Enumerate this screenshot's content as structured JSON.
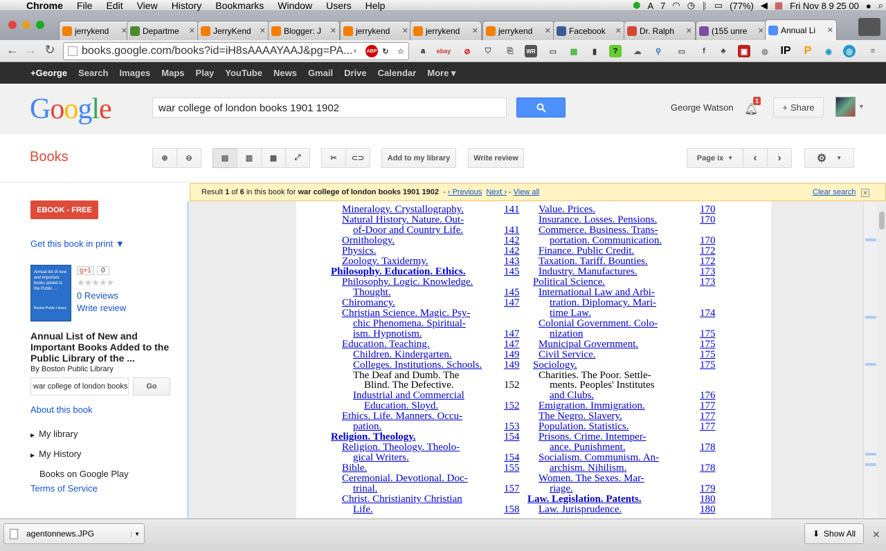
{
  "menubar": {
    "app": "Chrome",
    "items": [
      "File",
      "Edit",
      "View",
      "History",
      "Bookmarks",
      "Window",
      "Users",
      "Help"
    ],
    "battery": "(77%)",
    "clock": "Fri Nov 8  9 25 00",
    "badge_num": "7"
  },
  "tabs": [
    {
      "label": "jerrykend",
      "icon": "blogger-icon",
      "color": "#f57d00"
    },
    {
      "label": "Departme",
      "icon": "leaf-icon",
      "color": "#4a8a2e"
    },
    {
      "label": "JerryKend",
      "icon": "blogger-icon",
      "color": "#f57d00"
    },
    {
      "label": "Blogger: J",
      "icon": "blogger-icon",
      "color": "#f57d00"
    },
    {
      "label": "jerrykend",
      "icon": "blogger-icon",
      "color": "#f57d00"
    },
    {
      "label": "jerrykend",
      "icon": "blogger-icon",
      "color": "#f57d00"
    },
    {
      "label": "jerrykend",
      "icon": "blogger-icon",
      "color": "#f57d00"
    },
    {
      "label": "Facebook",
      "icon": "facebook-icon",
      "color": "#3b5998"
    },
    {
      "label": "Dr. Ralph",
      "icon": "gmail-icon",
      "color": "#d14836"
    },
    {
      "label": "(155 unre",
      "icon": "mail-icon",
      "color": "#7b4fa3"
    },
    {
      "label": "Annual Li",
      "icon": "google-icon",
      "color": "#4d90fe"
    }
  ],
  "toolbar": {
    "url": "books.google.com/books?id=iH8sAAAAYAAJ&pg=PA..."
  },
  "gbar": [
    "+George",
    "Search",
    "Images",
    "Maps",
    "Play",
    "YouTube",
    "News",
    "Gmail",
    "Drive",
    "Calendar",
    "More ▾"
  ],
  "header": {
    "logo": "Google",
    "query": "war college of london books 1901 1902",
    "user": "George Watson",
    "notif_count": "1",
    "share": "Share"
  },
  "books": {
    "title": "Books",
    "add_library": "Add to my library",
    "write_review": "Write review",
    "page_select": "Page ix"
  },
  "sidebar": {
    "ebook": "EBOOK - FREE",
    "get_print": "Get this book in print ▼",
    "cover_text": "Annual list of new and important books added to the Public ...",
    "cover_pub": "Boston Public Library",
    "gplus": "g+1",
    "gplus_count": "0",
    "reviews": "0 Reviews",
    "write_review": "Write review",
    "book_title": "Annual List of New and Important Books Added to the Public Library of the ...",
    "author": "By Boston Public Library",
    "search_value": "war college of london books",
    "go": "Go",
    "about": "About this book",
    "my_library": "My library",
    "my_history": "My History",
    "play": "Books on Google Play",
    "terms": "Terms of Service"
  },
  "resultbar": {
    "result_prefix": "Result ",
    "result_num": "1",
    "of_text": " of ",
    "total": "6",
    "in_book": " in this book for ",
    "query": "war college of london books 1901 1902",
    "prev": "‹ Previous",
    "next": "Next ›",
    "view_all": "View all",
    "clear": "Clear search"
  },
  "page": {
    "left_col": [
      {
        "t": "Mineralogy.  Crystallography.",
        "p": "141",
        "i": 1,
        "hl": true
      },
      {
        "t": "Natural History.  Nature.  Out-",
        "p": "",
        "i": 1,
        "hl": true
      },
      {
        "t": "of-Door and Country Life.",
        "p": "141",
        "i": 2,
        "hl": true
      },
      {
        "t": "Ornithology.",
        "p": "142",
        "i": 1,
        "hl": true
      },
      {
        "t": "Physics.",
        "p": "142",
        "i": 1,
        "hl": true
      },
      {
        "t": "Zoology.  Taxidermy.",
        "p": "143",
        "i": 1,
        "hl": true
      },
      {
        "t": "Philosophy.  Education.  Ethics.",
        "p": "145",
        "i": 0,
        "hl": true,
        "sec": true
      },
      {
        "t": "Philosophy.  Logic.  Knowledge.",
        "p": "",
        "i": 1,
        "hl": true
      },
      {
        "t": "Thought.",
        "p": "145",
        "i": 2,
        "hl": true
      },
      {
        "t": "Chiromancy.",
        "p": "147",
        "i": 1,
        "hl": true
      },
      {
        "t": "Christian Science.  Magic.  Psy-",
        "p": "",
        "i": 1,
        "hl": true
      },
      {
        "t": "chic  Phenomena.  Spiritual-",
        "p": "",
        "i": 2,
        "hl": true
      },
      {
        "t": "ism.  Hypnotism.",
        "p": "147",
        "i": 2,
        "hl": true
      },
      {
        "t": "Education.  Teaching.",
        "p": "147",
        "i": 1,
        "hl": true
      },
      {
        "t": "Children.  Kindergarten.",
        "p": "149",
        "i": 2,
        "hl": true
      },
      {
        "t": "Colleges. Institutions. Schools.",
        "p": "149",
        "i": 2,
        "hl": true
      },
      {
        "t": "The  Deaf  and  Dumb.   The",
        "p": "",
        "i": 2,
        "hl": false
      },
      {
        "t": "Blind.  The Defective.",
        "p": "152",
        "i": 3,
        "hl": false
      },
      {
        "t": "Industrial  and  Commercial",
        "p": "",
        "i": 2,
        "hl": true
      },
      {
        "t": "Education.  Sloyd.",
        "p": "152",
        "i": 3,
        "hl": true
      },
      {
        "t": "Ethics.  Life.  Manners.  Occu-",
        "p": "",
        "i": 1,
        "hl": true
      },
      {
        "t": "pation.",
        "p": "153",
        "i": 2,
        "hl": true
      },
      {
        "t": "Religion.  Theology.",
        "p": "154",
        "i": 0,
        "hl": true,
        "sec": true
      },
      {
        "t": "Religion.  Theology.  Theolo-",
        "p": "",
        "i": 1,
        "hl": true
      },
      {
        "t": "gical Writers.",
        "p": "154",
        "i": 2,
        "hl": true
      },
      {
        "t": "Bible.",
        "p": "155",
        "i": 1,
        "hl": true
      },
      {
        "t": "Ceremonial.  Devotional.  Doc-",
        "p": "",
        "i": 1,
        "hl": true
      },
      {
        "t": "trinal.",
        "p": "157",
        "i": 2,
        "hl": true
      },
      {
        "t": "Christ.  Christianity  Christian",
        "p": "",
        "i": 1,
        "hl": true
      },
      {
        "t": "Life.",
        "p": "158",
        "i": 2,
        "hl": true
      }
    ],
    "right_col": [
      {
        "t": "Value.  Prices.",
        "p": "170",
        "i": 1,
        "hl": true
      },
      {
        "t": "Insurance.  Losses.  Pensions.",
        "p": "170",
        "i": 1,
        "hl": true
      },
      {
        "t": "Commerce.  Business.  Trans-",
        "p": "",
        "i": 1,
        "hl": true
      },
      {
        "t": "portation.  Communication.",
        "p": "170",
        "i": 2,
        "hl": true
      },
      {
        "t": "Finance.  Public Credit.",
        "p": "172",
        "i": 1,
        "hl": true
      },
      {
        "t": "Taxation.  Tariff.  Bounties.",
        "p": "172",
        "i": 1,
        "hl": true
      },
      {
        "t": "Industry.  Manufactures.",
        "p": "173",
        "i": 1,
        "hl": true
      },
      {
        "t": "Political Science.",
        "p": "173",
        "i": 0.5,
        "hl": true
      },
      {
        "t": "International  Law  and  Arbi-",
        "p": "",
        "i": 1,
        "hl": true
      },
      {
        "t": "tration.  Diplomacy.  Mari-",
        "p": "",
        "i": 2,
        "hl": true
      },
      {
        "t": "time Law.",
        "p": "174",
        "i": 2,
        "hl": true
      },
      {
        "t": "Colonial  Government.  Colo-",
        "p": "",
        "i": 1,
        "hl": true
      },
      {
        "t": "nization",
        "p": "175",
        "i": 2,
        "hl": true
      },
      {
        "t": "Municipal Government.",
        "p": "175",
        "i": 1,
        "hl": true
      },
      {
        "t": "Civil Service.",
        "p": "175",
        "i": 1,
        "hl": true
      },
      {
        "t": "Sociology.",
        "p": "175",
        "i": 0.5,
        "hl": true
      },
      {
        "t": "Charities.  The Poor.  Settle-",
        "p": "",
        "i": 1,
        "hl": false
      },
      {
        "t": "ments.  Peoples' Institutes",
        "p": "",
        "i": 2,
        "hl": false
      },
      {
        "t": "and Clubs.",
        "p": "176",
        "i": 2,
        "hl": true
      },
      {
        "t": "Emigration.  Immigration.",
        "p": "177",
        "i": 1,
        "hl": true
      },
      {
        "t": "The Negro.  Slavery.",
        "p": "177",
        "i": 1,
        "hl": true
      },
      {
        "t": "Population.  Statistics.",
        "p": "177",
        "i": 1,
        "hl": true
      },
      {
        "t": "Prisons.  Crime.  Intemper-",
        "p": "",
        "i": 1,
        "hl": true
      },
      {
        "t": "ance.  Punishment.",
        "p": "178",
        "i": 2,
        "hl": true
      },
      {
        "t": "Socialism.  Communism.  An-",
        "p": "",
        "i": 1,
        "hl": true
      },
      {
        "t": "archism.  Nihilism.",
        "p": "178",
        "i": 2,
        "hl": true
      },
      {
        "t": "Women.  The Sexes.  Mar-",
        "p": "",
        "i": 1,
        "hl": true
      },
      {
        "t": "riage.",
        "p": "179",
        "i": 2,
        "hl": true
      },
      {
        "t": "Law.  Legislation.  Patents.",
        "p": "180",
        "i": 0,
        "hl": true,
        "sec": true
      },
      {
        "t": "Law.  Jurisprudence.",
        "p": "180",
        "i": 1,
        "hl": true
      }
    ]
  },
  "download": {
    "file": "agentonnews.JPG",
    "show_all": "Show All"
  },
  "colors": {
    "accent": "#dd4b39",
    "link": "#1155cc",
    "search_btn": "#4d90fe",
    "gbar": "#2d2d2d",
    "result_bg": "#fff4c2"
  }
}
